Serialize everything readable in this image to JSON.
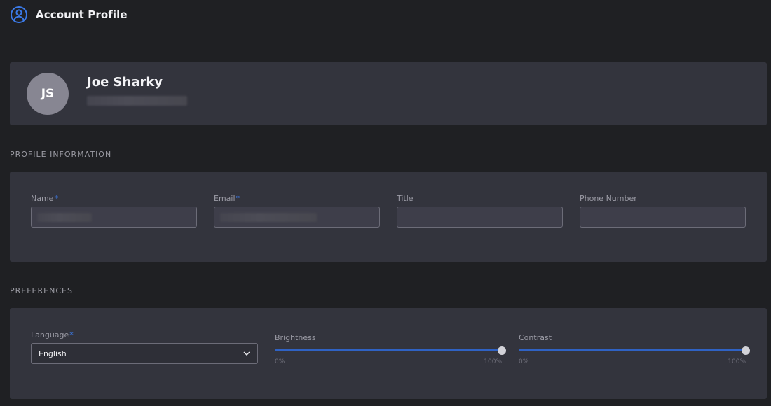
{
  "header": {
    "title": "Account Profile",
    "icon": "user-circle-icon",
    "accent_color": "#3b7ae8"
  },
  "profile": {
    "initials": "JS",
    "name": "Joe Sharky",
    "email_redacted": true
  },
  "profile_information": {
    "section_title": "PROFILE INFORMATION",
    "fields": [
      {
        "label": "Name",
        "required": true,
        "value_redacted": true,
        "value": ""
      },
      {
        "label": "Email",
        "required": true,
        "value_redacted": true,
        "value": ""
      },
      {
        "label": "Title",
        "required": false,
        "value_redacted": false,
        "value": ""
      },
      {
        "label": "Phone Number",
        "required": false,
        "value_redacted": false,
        "value": ""
      }
    ],
    "required_marker": "*"
  },
  "preferences": {
    "section_title": "PREFERENCES",
    "language": {
      "label": "Language",
      "required": true,
      "selected": "English",
      "icon": "chevron-down-icon"
    },
    "brightness": {
      "label": "Brightness",
      "value_percent": 100,
      "min_label": "0%",
      "max_label": "100%"
    },
    "contrast": {
      "label": "Contrast",
      "value_percent": 100,
      "min_label": "0%",
      "max_label": "100%"
    },
    "slider_color": "#2f62c4"
  }
}
